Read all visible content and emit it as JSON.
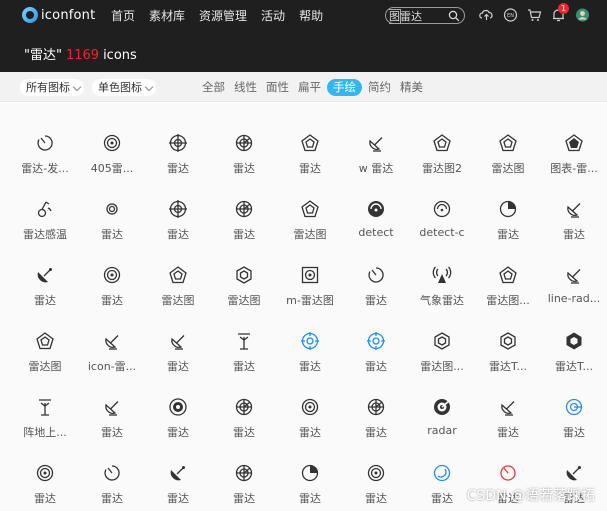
{
  "topbar": {
    "logo_text": "iconfont",
    "nav": [
      "首页",
      "素材库",
      "资源管理",
      "活动",
      "帮助"
    ],
    "search": {
      "value_prefix": "图",
      "value_rest": "雷达"
    },
    "notification_count": "1"
  },
  "title": {
    "quote_term": "\"雷达\"",
    "count": "1169",
    "unit": "icons"
  },
  "filters": {
    "scope": "所有图标",
    "color": "单色图标",
    "tabs": [
      "全部",
      "线性",
      "面性",
      "扁平",
      "手绘",
      "简约",
      "精美"
    ],
    "active_tab": "手绘"
  },
  "icons": [
    {
      "label": "雷达-发...",
      "glyph": "spin"
    },
    {
      "label": "405雷...",
      "glyph": "radar-ring"
    },
    {
      "label": "雷达",
      "glyph": "crosshair"
    },
    {
      "label": "雷达",
      "glyph": "radar-sweep"
    },
    {
      "label": "雷达",
      "glyph": "pentagon"
    },
    {
      "label": "w 雷达",
      "glyph": "dish"
    },
    {
      "label": "雷达图2",
      "glyph": "pentagon"
    },
    {
      "label": "雷达图",
      "glyph": "pentagon"
    },
    {
      "label": "图表-雷...",
      "glyph": "pentagon-filled"
    },
    {
      "label": "雷达感温",
      "glyph": "thermo"
    },
    {
      "label": "雷达",
      "glyph": "radar-small"
    },
    {
      "label": "雷达",
      "glyph": "crosshair"
    },
    {
      "label": "雷达",
      "glyph": "radar-sweep"
    },
    {
      "label": "雷达图",
      "glyph": "pentagon"
    },
    {
      "label": "detect",
      "glyph": "detect-filled"
    },
    {
      "label": "detect-c",
      "glyph": "detect-line"
    },
    {
      "label": "雷达",
      "glyph": "half-disc"
    },
    {
      "label": "雷达",
      "glyph": "dish"
    },
    {
      "label": "雷达",
      "glyph": "dish-filled"
    },
    {
      "label": "雷达",
      "glyph": "radar-ring"
    },
    {
      "label": "雷达图",
      "glyph": "pentagon"
    },
    {
      "label": "雷达图",
      "glyph": "hexagon"
    },
    {
      "label": "m-雷达图",
      "glyph": "square-radar"
    },
    {
      "label": "雷达",
      "glyph": "spin"
    },
    {
      "label": "气象雷达",
      "glyph": "tower"
    },
    {
      "label": "雷达图...",
      "glyph": "pentagon"
    },
    {
      "label": "line-rad...",
      "glyph": "dish"
    },
    {
      "label": "雷达图",
      "glyph": "pentagon"
    },
    {
      "label": "icon-雷...",
      "glyph": "dish"
    },
    {
      "label": "雷达",
      "glyph": "dish"
    },
    {
      "label": "雷达",
      "glyph": "antenna"
    },
    {
      "label": "雷达",
      "glyph": "crosshair-blue"
    },
    {
      "label": "雷达",
      "glyph": "crosshair-blue"
    },
    {
      "label": "雷达图...",
      "glyph": "hexagon"
    },
    {
      "label": "雷达T...",
      "glyph": "hexagon"
    },
    {
      "label": "雷达T...",
      "glyph": "hexagon-filled"
    },
    {
      "label": "阵地上...",
      "glyph": "antenna"
    },
    {
      "label": "雷达",
      "glyph": "dish"
    },
    {
      "label": "雷达",
      "glyph": "target-filled"
    },
    {
      "label": "雷达",
      "glyph": "radar-sweep"
    },
    {
      "label": "雷达",
      "glyph": "radar-ring"
    },
    {
      "label": "雷达",
      "glyph": "radar-sweep"
    },
    {
      "label": "radar",
      "glyph": "radar-black"
    },
    {
      "label": "雷达",
      "glyph": "dish"
    },
    {
      "label": "雷达",
      "glyph": "blue-circle"
    },
    {
      "label": "雷达",
      "glyph": "radar-ring"
    },
    {
      "label": "雷达",
      "glyph": "spin"
    },
    {
      "label": "雷达",
      "glyph": "dish-filled"
    },
    {
      "label": "雷达",
      "glyph": "radar-sweep"
    },
    {
      "label": "雷达",
      "glyph": "half-disc"
    },
    {
      "label": "雷达",
      "glyph": "radar-ring"
    },
    {
      "label": "雷达",
      "glyph": "blue-dish"
    },
    {
      "label": "雷达",
      "glyph": "red-spin"
    },
    {
      "label": "雷达",
      "glyph": "dish-filled"
    }
  ],
  "watermark": "CSDN @语若落踩拓",
  "colors": {
    "accent": "#35b6ef",
    "count_red": "#f5222d",
    "topbar_bg": "#1f1f1f"
  }
}
